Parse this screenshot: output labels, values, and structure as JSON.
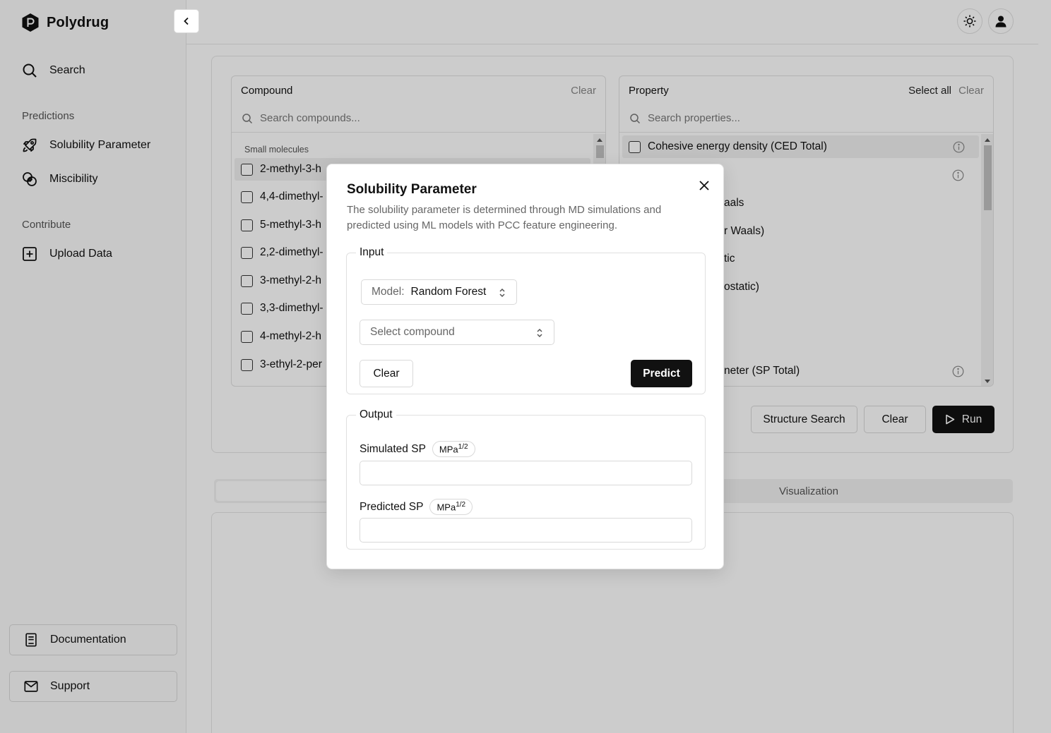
{
  "app": {
    "name": "Polydrug"
  },
  "sidebar": {
    "search_label": "Search",
    "predictions_heading": "Predictions",
    "items": [
      {
        "label": "Solubility Parameter",
        "icon": "rocket-icon"
      },
      {
        "label": "Miscibility",
        "icon": "circles-overlap-icon"
      }
    ],
    "contribute_heading": "Contribute",
    "upload_label": "Upload Data",
    "documentation_label": "Documentation",
    "support_label": "Support"
  },
  "compound_panel": {
    "title": "Compound",
    "clear_label": "Clear",
    "search_placeholder": "Search compounds...",
    "group_label": "Small molecules",
    "rows": [
      "2-methyl-3-h",
      "4,4-dimethyl-",
      "5-methyl-3-h",
      "2,2-dimethyl-",
      "3-methyl-2-h",
      "3,3-dimethyl-",
      "4-methyl-2-h",
      "3-ethyl-2-per"
    ]
  },
  "property_panel": {
    "title": "Property",
    "select_all_label": "Select all",
    "clear_label": "Clear",
    "search_placeholder": "Search properties...",
    "rows": [
      "Cohesive energy density (CED Total)",
      "",
      "aals",
      "r Waals)",
      "tic",
      "ostatic)",
      "",
      "",
      "neter (SP Total)"
    ]
  },
  "actions": {
    "structure_search_label": "Structure Search",
    "clear_label": "Clear",
    "run_label": "Run"
  },
  "tabs": {
    "visualization_label": "Visualization"
  },
  "modal": {
    "title": "Solubility Parameter",
    "description": "The solubility parameter is determined through MD simulations and predicted using ML models with PCC feature engineering.",
    "input_legend": "Input",
    "model_prefix": "Model:",
    "model_value": "Random Forest",
    "compound_placeholder": "Select compound",
    "clear_label": "Clear",
    "predict_label": "Predict",
    "output_legend": "Output",
    "simulated_label": "Simulated SP",
    "predicted_label": "Predicted SP",
    "unit_base": "MPa",
    "unit_exp": "1/2",
    "simulated_value": "",
    "predicted_value": ""
  },
  "colors": {
    "primary": "#111111",
    "muted": "#888888",
    "overlay": "rgba(0,0,0,0.20)"
  }
}
